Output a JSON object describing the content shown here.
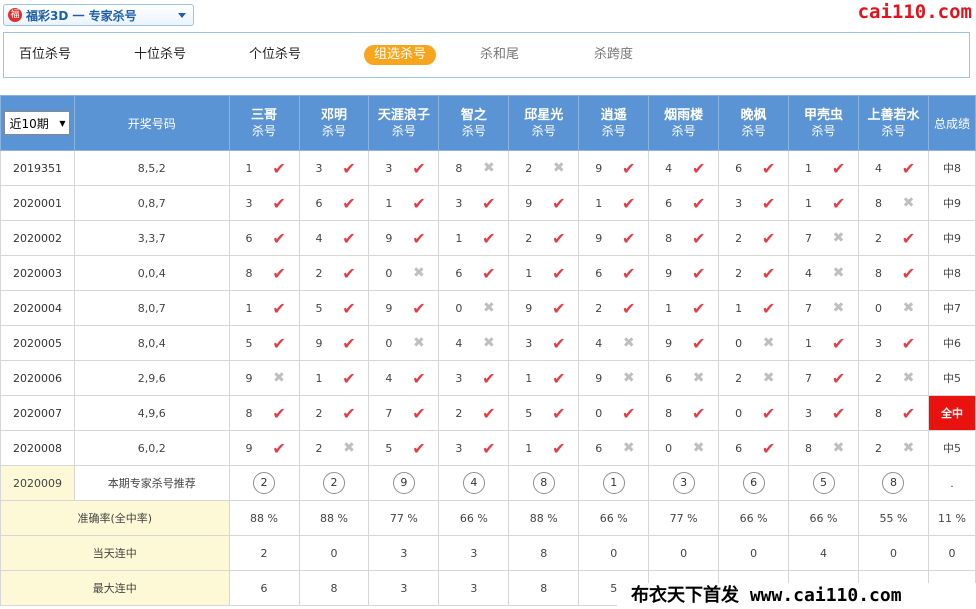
{
  "top": {
    "app_logo": "福",
    "dropdown_label": "福彩3D 一 专家杀号",
    "site_logo": "cai110.com"
  },
  "tabs": [
    {
      "label": "百位杀号",
      "state": "normal"
    },
    {
      "label": "十位杀号",
      "state": "normal"
    },
    {
      "label": "个位杀号",
      "state": "normal"
    },
    {
      "label": "组选杀号",
      "state": "active"
    },
    {
      "label": "杀和尾",
      "state": "muted"
    },
    {
      "label": "杀跨度",
      "state": "muted"
    }
  ],
  "table": {
    "filter_value": "近10期",
    "col_draw": "开奖号码",
    "col_total": "总成绩",
    "experts": [
      {
        "name": "三哥",
        "sub": "杀号"
      },
      {
        "name": "邓明",
        "sub": "杀号"
      },
      {
        "name": "天涯浪子",
        "sub": "杀号"
      },
      {
        "name": "智之",
        "sub": "杀号"
      },
      {
        "name": "邱星光",
        "sub": "杀号"
      },
      {
        "name": "逍遥",
        "sub": "杀号"
      },
      {
        "name": "烟雨楼",
        "sub": "杀号"
      },
      {
        "name": "晚枫",
        "sub": "杀号"
      },
      {
        "name": "甲壳虫",
        "sub": "杀号"
      },
      {
        "name": "上善若水",
        "sub": "杀号"
      }
    ],
    "rows": [
      {
        "period": "2019351",
        "draw": "8,5,2",
        "kills": [
          "1",
          "3",
          "3",
          "8",
          "2",
          "9",
          "4",
          "6",
          "1",
          "4"
        ],
        "hits": [
          1,
          1,
          1,
          0,
          0,
          1,
          1,
          1,
          1,
          1
        ],
        "total": "中8",
        "total_highlight": false
      },
      {
        "period": "2020001",
        "draw": "0,8,7",
        "kills": [
          "3",
          "6",
          "1",
          "3",
          "9",
          "1",
          "6",
          "3",
          "1",
          "8"
        ],
        "hits": [
          1,
          1,
          1,
          1,
          1,
          1,
          1,
          1,
          1,
          0
        ],
        "total": "中9",
        "total_highlight": false
      },
      {
        "period": "2020002",
        "draw": "3,3,7",
        "kills": [
          "6",
          "4",
          "9",
          "1",
          "2",
          "9",
          "8",
          "2",
          "7",
          "2"
        ],
        "hits": [
          1,
          1,
          1,
          1,
          1,
          1,
          1,
          1,
          0,
          1
        ],
        "total": "中9",
        "total_highlight": false
      },
      {
        "period": "2020003",
        "draw": "0,0,4",
        "kills": [
          "8",
          "2",
          "0",
          "6",
          "1",
          "6",
          "9",
          "2",
          "4",
          "8"
        ],
        "hits": [
          1,
          1,
          0,
          1,
          1,
          1,
          1,
          1,
          0,
          1
        ],
        "total": "中8",
        "total_highlight": false
      },
      {
        "period": "2020004",
        "draw": "8,0,7",
        "kills": [
          "1",
          "5",
          "9",
          "0",
          "9",
          "2",
          "1",
          "1",
          "7",
          "0"
        ],
        "hits": [
          1,
          1,
          1,
          0,
          1,
          1,
          1,
          1,
          0,
          0
        ],
        "total": "中7",
        "total_highlight": false
      },
      {
        "period": "2020005",
        "draw": "8,0,4",
        "kills": [
          "5",
          "9",
          "0",
          "4",
          "3",
          "4",
          "9",
          "0",
          "1",
          "3"
        ],
        "hits": [
          1,
          1,
          0,
          0,
          1,
          0,
          1,
          0,
          1,
          1
        ],
        "total": "中6",
        "total_highlight": false
      },
      {
        "period": "2020006",
        "draw": "2,9,6",
        "kills": [
          "9",
          "1",
          "4",
          "3",
          "1",
          "9",
          "6",
          "2",
          "7",
          "2"
        ],
        "hits": [
          0,
          1,
          1,
          1,
          1,
          0,
          0,
          0,
          1,
          0
        ],
        "total": "中5",
        "total_highlight": false
      },
      {
        "period": "2020007",
        "draw": "4,9,6",
        "kills": [
          "8",
          "2",
          "7",
          "2",
          "5",
          "0",
          "8",
          "0",
          "3",
          "8"
        ],
        "hits": [
          1,
          1,
          1,
          1,
          1,
          1,
          1,
          1,
          1,
          1
        ],
        "total": "全中",
        "total_highlight": true
      },
      {
        "period": "2020008",
        "draw": "6,0,2",
        "kills": [
          "9",
          "2",
          "5",
          "3",
          "1",
          "6",
          "0",
          "6",
          "8",
          "2"
        ],
        "hits": [
          1,
          0,
          1,
          1,
          1,
          0,
          0,
          1,
          0,
          0
        ],
        "total": "中5",
        "total_highlight": false
      }
    ],
    "recommend": {
      "period": "2020009",
      "label": "本期专家杀号推荐",
      "numbers": [
        "2",
        "2",
        "9",
        "4",
        "8",
        "1",
        "3",
        "6",
        "5",
        "8"
      ],
      "total": "."
    },
    "stats": [
      {
        "label": "准确率(全中率)",
        "values": [
          "88 %",
          "88 %",
          "77 %",
          "66 %",
          "88 %",
          "66 %",
          "77 %",
          "66 %",
          "66 %",
          "55 %"
        ],
        "total": "11 %"
      },
      {
        "label": "当天连中",
        "values": [
          "2",
          "0",
          "3",
          "3",
          "8",
          "0",
          "0",
          "0",
          "4",
          "0"
        ],
        "total": "0"
      },
      {
        "label": "最大连中",
        "values": [
          "6",
          "8",
          "3",
          "3",
          "8",
          "5",
          "",
          "",
          "",
          "",
          ""
        ],
        "total": ""
      }
    ]
  },
  "watermark": "布衣天下首发 www.cai110.com",
  "colors": {
    "header_blue": "#5b94d4",
    "hit_red": "#e83b45",
    "miss_gray": "#bfbfbf",
    "active_tab": "#f7a51c",
    "highlight_red": "#e8120e",
    "stat_bg": "#fdf9d7"
  }
}
